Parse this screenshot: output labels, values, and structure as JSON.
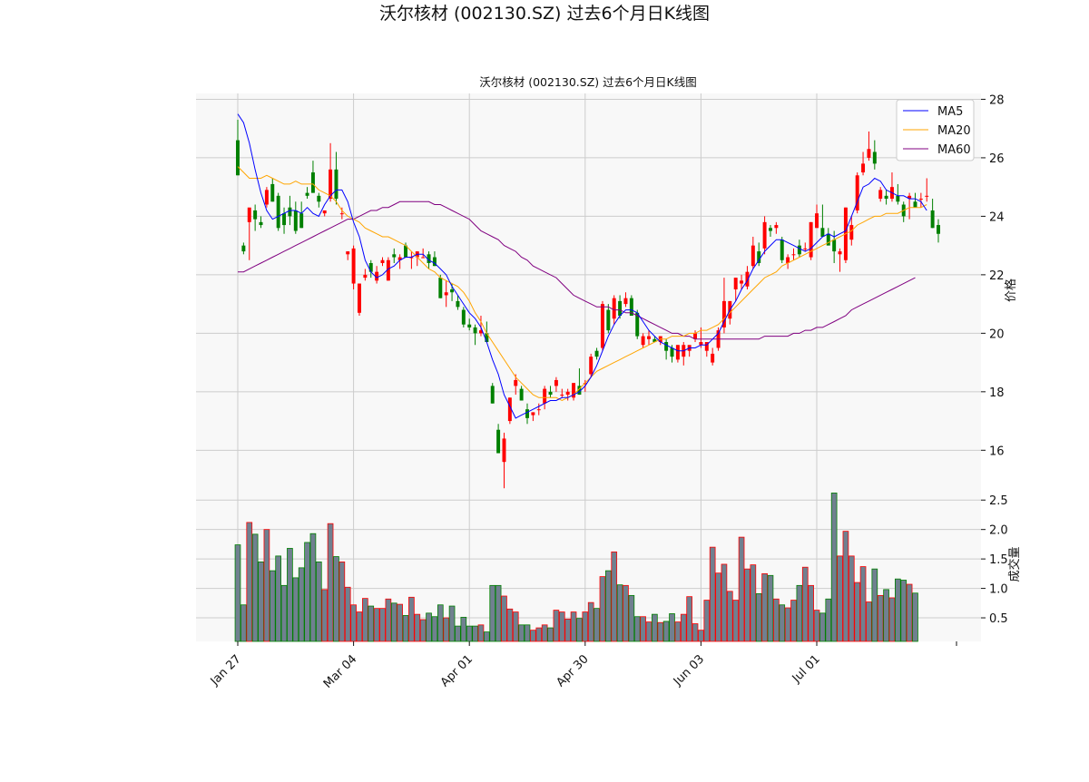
{
  "figure": {
    "suptitle": "沃尔核材 (002130.SZ) 过去6个月日K线图",
    "axes_title": "沃尔核材 (002130.SZ) 过去6个月日K线图",
    "price_ylabel": "价格",
    "volume_ylabel": "成交量",
    "x_tick_labels": [
      "Jan 27",
      "Mar 04",
      "Apr 01",
      "Apr 30",
      "Jun 03",
      "Jul 01"
    ],
    "price_tick_labels": [
      "16",
      "18",
      "20",
      "22",
      "24",
      "26",
      "28"
    ],
    "volume_tick_labels": [
      "0.5",
      "1.0",
      "1.5",
      "2.0",
      "2.5"
    ],
    "legend": [
      "MA5",
      "MA20",
      "MA60"
    ]
  },
  "chart_data": {
    "type": "candlestick",
    "price_ylim": [
      14.8,
      28.2
    ],
    "volume_ylim": [
      0.1,
      2.75
    ],
    "grid": true,
    "legend_position": "top-right",
    "colors": {
      "up": "#ff0000",
      "down": "#008000",
      "volume_bar": "#708090",
      "ma5": "#0000ff",
      "ma20": "#ffa500",
      "ma60": "#800080",
      "background": "#f8f8f8",
      "grid": "#cccccc"
    },
    "x_ticks": [
      {
        "label": "Jan 27",
        "index": 0
      },
      {
        "label": "Mar 04",
        "index": 20
      },
      {
        "label": "Apr 01",
        "index": 40
      },
      {
        "label": "Apr 30",
        "index": 60
      },
      {
        "label": "Jun 03",
        "index": 80
      },
      {
        "label": "Jul 01",
        "index": 100
      }
    ],
    "price_ticks": [
      16,
      18,
      20,
      22,
      24,
      26,
      28
    ],
    "volume_ticks": [
      0.5,
      1.0,
      1.5,
      2.0,
      2.5
    ],
    "ohlc": [
      [
        26.6,
        27.3,
        25.4,
        25.4
      ],
      [
        23.0,
        23.1,
        22.7,
        22.8
      ],
      [
        23.8,
        24.0,
        22.5,
        24.3
      ],
      [
        24.2,
        24.4,
        23.5,
        23.9
      ],
      [
        23.8,
        24.0,
        23.6,
        23.7
      ],
      [
        24.4,
        25.0,
        24.3,
        24.9
      ],
      [
        25.1,
        25.3,
        24.5,
        24.5
      ],
      [
        24.7,
        24.8,
        23.5,
        23.6
      ],
      [
        24.1,
        24.3,
        23.4,
        23.7
      ],
      [
        24.3,
        24.7,
        23.7,
        24.0
      ],
      [
        24.2,
        24.5,
        23.4,
        23.5
      ],
      [
        24.1,
        24.5,
        23.6,
        23.6
      ],
      [
        24.8,
        25.0,
        24.6,
        24.7
      ],
      [
        25.5,
        25.9,
        24.8,
        24.8
      ],
      [
        24.7,
        24.8,
        24.3,
        24.5
      ],
      [
        24.1,
        24.2,
        24.0,
        24.2
      ],
      [
        24.6,
        26.5,
        24.5,
        25.6
      ],
      [
        25.6,
        26.2,
        24.4,
        24.6
      ],
      [
        24.1,
        24.3,
        23.9,
        24.1
      ],
      [
        22.7,
        22.8,
        22.5,
        22.8
      ],
      [
        21.7,
        23.0,
        21.5,
        22.9
      ],
      [
        20.7,
        21.7,
        20.6,
        21.7
      ],
      [
        21.9,
        22.2,
        21.8,
        22.0
      ],
      [
        22.4,
        22.5,
        21.9,
        22.1
      ],
      [
        21.8,
        22.3,
        21.7,
        22.1
      ],
      [
        22.4,
        22.6,
        22.3,
        22.5
      ],
      [
        21.8,
        22.6,
        21.8,
        22.5
      ],
      [
        22.7,
        22.9,
        22.4,
        22.6
      ],
      [
        22.5,
        22.7,
        22.2,
        22.6
      ],
      [
        23.0,
        23.1,
        22.9,
        22.6
      ],
      [
        22.6,
        22.8,
        22.2,
        22.6
      ],
      [
        22.6,
        22.8,
        22.3,
        22.8
      ],
      [
        22.6,
        22.9,
        22.6,
        22.6
      ],
      [
        22.7,
        22.8,
        22.2,
        22.4
      ],
      [
        22.6,
        22.8,
        22.3,
        22.3
      ],
      [
        21.9,
        22.0,
        21.2,
        21.2
      ],
      [
        21.3,
        21.8,
        20.9,
        21.4
      ],
      [
        21.5,
        21.7,
        21.1,
        21.4
      ],
      [
        21.1,
        21.3,
        20.8,
        20.9
      ],
      [
        20.8,
        20.9,
        20.2,
        20.3
      ],
      [
        20.3,
        20.5,
        20.1,
        20.2
      ],
      [
        20.2,
        20.3,
        19.6,
        20.0
      ],
      [
        20.0,
        20.6,
        19.9,
        20.1
      ],
      [
        20.0,
        20.4,
        19.7,
        19.7
      ],
      [
        18.2,
        18.3,
        17.6,
        17.6
      ],
      [
        16.7,
        16.9,
        15.9,
        15.9
      ],
      [
        15.6,
        16.6,
        14.7,
        16.4
      ],
      [
        17.0,
        17.8,
        16.9,
        17.8
      ],
      [
        18.2,
        18.6,
        17.9,
        18.4
      ],
      [
        18.1,
        18.2,
        17.7,
        17.7
      ],
      [
        17.4,
        17.6,
        16.9,
        17.1
      ],
      [
        17.2,
        17.3,
        17.0,
        17.3
      ],
      [
        17.4,
        17.6,
        17.2,
        17.4
      ],
      [
        17.6,
        18.2,
        17.4,
        18.1
      ],
      [
        18.0,
        18.2,
        17.8,
        17.9
      ],
      [
        18.2,
        18.5,
        18.0,
        18.4
      ],
      [
        17.9,
        18.1,
        17.8,
        17.9
      ],
      [
        17.9,
        18.1,
        17.7,
        18.0
      ],
      [
        17.8,
        18.3,
        17.7,
        18.3
      ],
      [
        18.2,
        18.8,
        17.9,
        17.9
      ],
      [
        18.3,
        18.4,
        18.0,
        18.3
      ],
      [
        18.6,
        19.3,
        18.5,
        19.2
      ],
      [
        19.4,
        19.5,
        19.1,
        19.2
      ],
      [
        19.5,
        21.1,
        19.4,
        21.0
      ],
      [
        20.8,
        21.0,
        20.0,
        20.1
      ],
      [
        20.5,
        21.3,
        20.3,
        21.2
      ],
      [
        21.1,
        21.3,
        20.5,
        20.6
      ],
      [
        21.0,
        21.4,
        20.9,
        21.2
      ],
      [
        21.2,
        21.3,
        20.7,
        20.6
      ],
      [
        20.7,
        20.8,
        19.8,
        19.9
      ],
      [
        19.6,
        20.0,
        19.5,
        19.9
      ],
      [
        19.8,
        20.1,
        19.6,
        19.9
      ],
      [
        19.8,
        19.9,
        19.7,
        19.7
      ],
      [
        19.7,
        19.9,
        19.6,
        19.9
      ],
      [
        19.7,
        19.8,
        19.1,
        19.4
      ],
      [
        19.5,
        19.6,
        19.0,
        19.2
      ],
      [
        19.1,
        19.6,
        19.0,
        19.6
      ],
      [
        19.2,
        19.7,
        18.9,
        19.6
      ],
      [
        19.4,
        19.5,
        19.2,
        19.6
      ],
      [
        19.8,
        20.1,
        19.7,
        20.0
      ],
      [
        19.6,
        20.2,
        19.5,
        19.7
      ],
      [
        19.4,
        19.6,
        19.2,
        19.7
      ],
      [
        19.0,
        19.5,
        18.9,
        19.3
      ],
      [
        19.5,
        20.2,
        19.4,
        20.1
      ],
      [
        20.2,
        21.9,
        20.0,
        21.1
      ],
      [
        20.5,
        21.1,
        20.3,
        21.1
      ],
      [
        21.5,
        21.9,
        21.1,
        21.9
      ],
      [
        21.7,
        22.0,
        21.5,
        21.8
      ],
      [
        21.6,
        22.3,
        21.5,
        22.1
      ],
      [
        22.3,
        23.3,
        22.2,
        23.0
      ],
      [
        22.8,
        23.1,
        22.3,
        22.4
      ],
      [
        22.9,
        24.0,
        22.7,
        23.8
      ],
      [
        23.6,
        23.7,
        23.3,
        23.5
      ],
      [
        23.6,
        23.8,
        23.4,
        23.7
      ],
      [
        23.2,
        23.3,
        22.4,
        22.5
      ],
      [
        22.4,
        22.7,
        22.2,
        22.6
      ],
      [
        22.7,
        22.9,
        22.5,
        22.7
      ],
      [
        23.0,
        23.2,
        22.6,
        22.7
      ],
      [
        22.9,
        23.1,
        22.8,
        22.9
      ],
      [
        22.6,
        23.8,
        22.5,
        23.8
      ],
      [
        23.6,
        24.4,
        23.6,
        24.1
      ],
      [
        23.6,
        24.4,
        23.4,
        23.3
      ],
      [
        23.4,
        23.6,
        23.2,
        23.0
      ],
      [
        23.2,
        23.5,
        22.4,
        22.8
      ],
      [
        22.7,
        22.9,
        22.1,
        22.8
      ],
      [
        22.5,
        24.3,
        22.4,
        24.3
      ],
      [
        23.2,
        24.0,
        23.0,
        23.7
      ],
      [
        24.2,
        25.5,
        24.1,
        25.4
      ],
      [
        25.5,
        26.2,
        25.4,
        25.8
      ],
      [
        26.0,
        26.9,
        25.9,
        26.3
      ],
      [
        26.2,
        26.6,
        25.6,
        25.8
      ],
      [
        24.6,
        25.0,
        24.5,
        24.9
      ],
      [
        24.7,
        24.9,
        24.4,
        24.6
      ],
      [
        24.6,
        25.5,
        24.5,
        25.0
      ],
      [
        24.7,
        25.1,
        24.4,
        24.5
      ],
      [
        24.4,
        24.5,
        23.8,
        24.0
      ],
      [
        24.6,
        24.8,
        23.9,
        24.7
      ],
      [
        24.5,
        24.8,
        24.3,
        24.3
      ],
      [
        24.6,
        24.8,
        24.3,
        24.6
      ],
      [
        24.7,
        25.3,
        24.5,
        24.7
      ],
      [
        24.2,
        24.6,
        23.6,
        23.6
      ],
      [
        23.7,
        23.9,
        23.1,
        23.4
      ]
    ],
    "volume": [
      1.74,
      0.72,
      2.12,
      1.92,
      1.45,
      2.0,
      1.3,
      1.55,
      1.05,
      1.68,
      1.18,
      1.35,
      1.78,
      1.93,
      1.45,
      0.98,
      2.1,
      1.54,
      1.45,
      1.02,
      0.72,
      0.6,
      0.83,
      0.7,
      0.66,
      0.66,
      0.82,
      0.75,
      0.73,
      0.54,
      0.85,
      0.56,
      0.47,
      0.58,
      0.52,
      0.72,
      0.5,
      0.7,
      0.36,
      0.51,
      0.36,
      0.36,
      0.38,
      0.26,
      1.05,
      1.05,
      0.87,
      0.65,
      0.6,
      0.38,
      0.38,
      0.29,
      0.33,
      0.38,
      0.33,
      0.63,
      0.6,
      0.48,
      0.6,
      0.49,
      0.6,
      0.76,
      0.66,
      1.2,
      1.3,
      1.62,
      1.06,
      1.05,
      0.88,
      0.52,
      0.52,
      0.43,
      0.56,
      0.42,
      0.44,
      0.57,
      0.43,
      0.56,
      0.86,
      0.4,
      0.29,
      0.8,
      1.7,
      1.26,
      1.41,
      0.95,
      0.8,
      1.87,
      1.33,
      1.4,
      0.91,
      1.25,
      1.22,
      0.82,
      0.72,
      0.67,
      0.8,
      1.05,
      1.36,
      1.05,
      0.63,
      0.58,
      0.82,
      2.62,
      1.55,
      1.97,
      1.55,
      1.1,
      1.37,
      0.77,
      1.33,
      0.88,
      0.98,
      0.84,
      1.16,
      1.14,
      1.07,
      0.92
    ],
    "ma5": [
      27.5,
      27.2,
      26.5,
      25.6,
      24.8,
      24.2,
      23.9,
      24.0,
      24.1,
      24.2,
      24.2,
      24.1,
      24.3,
      24.1,
      24.0,
      24.4,
      24.7,
      24.9,
      24.9,
      24.5,
      23.8,
      23.3,
      22.5,
      22.1,
      21.9,
      22.0,
      22.2,
      22.3,
      22.5,
      22.6,
      22.6,
      22.7,
      22.7,
      22.5,
      22.4,
      22.2,
      22.0,
      21.6,
      21.3,
      21.0,
      20.7,
      20.5,
      20.2,
      19.7,
      19.1,
      18.6,
      17.9,
      17.5,
      17.1,
      17.2,
      17.3,
      17.4,
      17.5,
      17.6,
      17.7,
      17.7,
      17.8,
      17.8,
      17.9,
      18.0,
      18.2,
      18.5,
      18.9,
      19.4,
      19.9,
      20.3,
      20.6,
      20.8,
      20.8,
      20.7,
      20.4,
      20.1,
      19.9,
      19.7,
      19.6,
      19.5,
      19.4,
      19.4,
      19.5,
      19.5,
      19.6,
      19.6,
      19.8,
      20.0,
      20.4,
      20.8,
      21.1,
      21.5,
      21.8,
      22.2,
      22.5,
      22.8,
      23.0,
      23.2,
      23.2,
      23.1,
      23.0,
      22.9,
      22.8,
      22.9,
      23.1,
      23.3,
      23.4,
      23.3,
      23.4,
      23.5,
      24.0,
      24.5,
      25.0,
      25.1,
      25.3,
      25.2,
      24.9,
      24.8,
      24.7,
      24.7,
      24.6,
      24.6,
      24.5,
      24.2
    ],
    "ma20": [
      25.7,
      25.5,
      25.3,
      25.3,
      25.3,
      25.4,
      25.3,
      25.2,
      25.1,
      25.1,
      25.2,
      25.1,
      25.1,
      25.1,
      24.9,
      24.8,
      24.7,
      24.5,
      24.2,
      24.0,
      23.9,
      23.8,
      23.6,
      23.5,
      23.4,
      23.3,
      23.3,
      23.2,
      23.1,
      23.0,
      22.8,
      22.6,
      22.4,
      22.2,
      22.1,
      21.9,
      21.8,
      21.7,
      21.6,
      21.4,
      21.1,
      20.7,
      20.4,
      20.0,
      19.7,
      19.4,
      19.1,
      18.8,
      18.5,
      18.3,
      18.1,
      17.9,
      17.8,
      17.8,
      17.8,
      17.8,
      17.7,
      17.8,
      17.9,
      18.1,
      18.3,
      18.5,
      18.7,
      18.8,
      18.9,
      19.0,
      19.1,
      19.2,
      19.3,
      19.4,
      19.5,
      19.6,
      19.7,
      19.8,
      19.8,
      19.9,
      19.9,
      19.9,
      20.0,
      20.0,
      20.1,
      20.1,
      20.2,
      20.3,
      20.5,
      20.7,
      20.9,
      21.1,
      21.3,
      21.5,
      21.7,
      21.9,
      22.0,
      22.1,
      22.3,
      22.4,
      22.5,
      22.6,
      22.7,
      22.8,
      22.9,
      23.0,
      23.1,
      23.2,
      23.3,
      23.4,
      23.5,
      23.7,
      23.8,
      23.9,
      24.0,
      24.0,
      24.1,
      24.1,
      24.1,
      24.2,
      24.3,
      24.3,
      24.3,
      24.4
    ],
    "ma60": [
      22.1,
      22.1,
      22.2,
      22.3,
      22.4,
      22.5,
      22.6,
      22.7,
      22.8,
      22.9,
      23.0,
      23.1,
      23.2,
      23.3,
      23.4,
      23.5,
      23.6,
      23.7,
      23.8,
      23.9,
      23.9,
      24.0,
      24.1,
      24.2,
      24.2,
      24.3,
      24.3,
      24.4,
      24.5,
      24.5,
      24.5,
      24.5,
      24.5,
      24.5,
      24.4,
      24.4,
      24.3,
      24.2,
      24.1,
      24.0,
      23.9,
      23.7,
      23.5,
      23.4,
      23.3,
      23.2,
      23.0,
      22.9,
      22.8,
      22.6,
      22.5,
      22.3,
      22.2,
      22.1,
      22.0,
      21.9,
      21.7,
      21.5,
      21.3,
      21.2,
      21.1,
      21.0,
      20.9,
      20.9,
      20.9,
      20.8,
      20.8,
      20.7,
      20.7,
      20.6,
      20.5,
      20.4,
      20.3,
      20.2,
      20.1,
      20.0,
      20.0,
      19.9,
      19.9,
      19.8,
      19.8,
      19.8,
      19.8,
      19.8,
      19.8,
      19.8,
      19.8,
      19.8,
      19.8,
      19.8,
      19.8,
      19.9,
      19.9,
      19.9,
      19.9,
      19.9,
      20.0,
      20.0,
      20.1,
      20.1,
      20.2,
      20.2,
      20.3,
      20.4,
      20.5,
      20.6,
      20.8,
      20.9,
      21.0,
      21.1,
      21.2,
      21.3,
      21.4,
      21.5,
      21.6,
      21.7,
      21.8,
      21.9
    ]
  }
}
